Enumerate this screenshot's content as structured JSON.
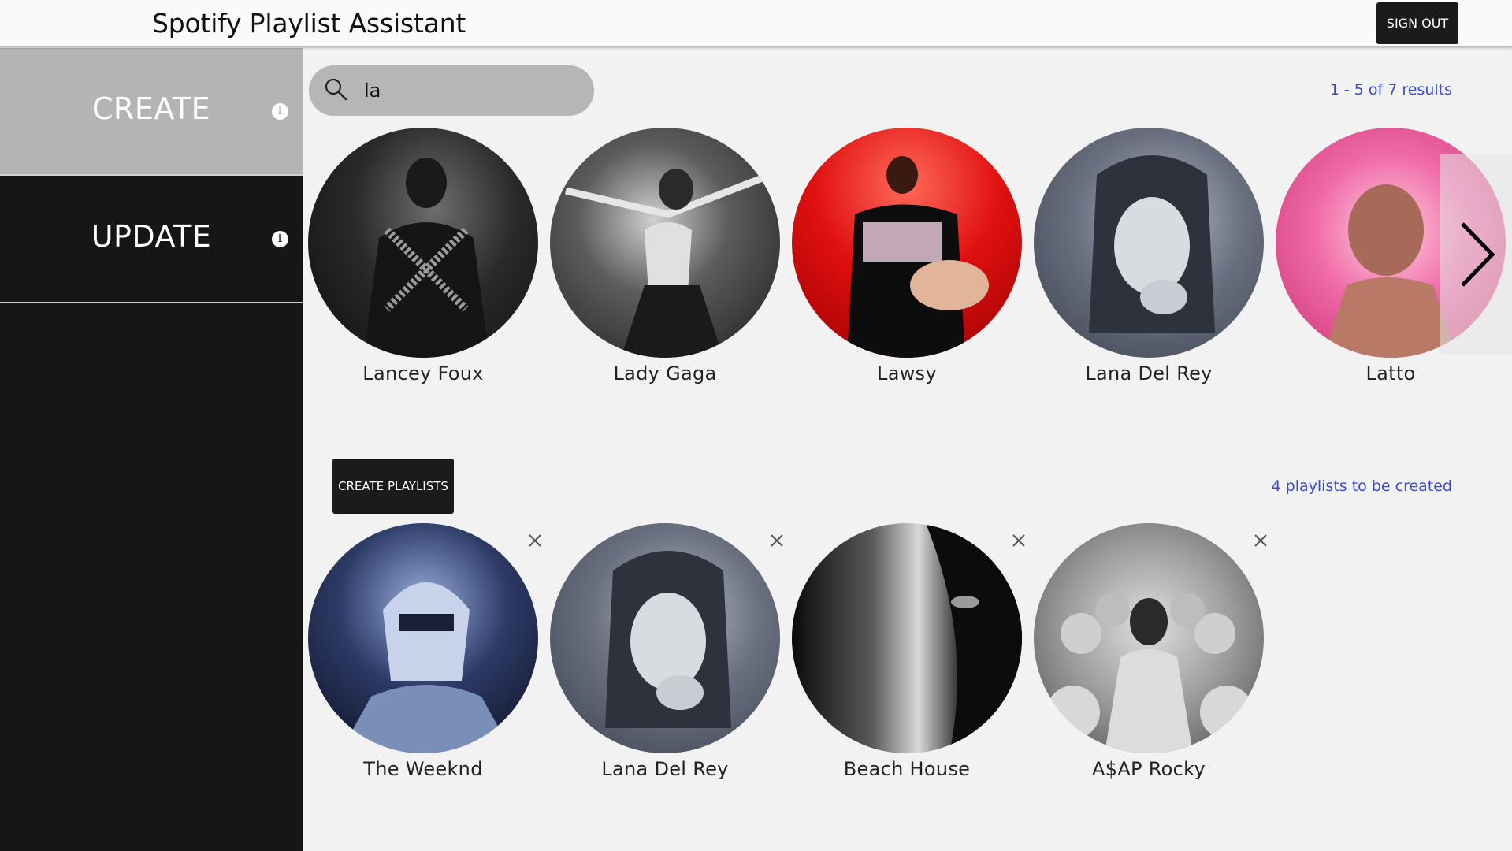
{
  "header": {
    "title": "Spotify Playlist Assistant",
    "signout_label": "SIGN OUT"
  },
  "sidebar": {
    "items": [
      {
        "label": "CREATE",
        "active": true
      },
      {
        "label": "UPDATE",
        "active": false
      }
    ],
    "info_icon": "info-icon"
  },
  "search": {
    "value": "la",
    "placeholder": ""
  },
  "results": {
    "count_text": "1 - 5 of 7 results"
  },
  "artists": [
    {
      "name": "Lancey Foux"
    },
    {
      "name": "Lady Gaga"
    },
    {
      "name": "Lawsy"
    },
    {
      "name": "Lana Del Rey"
    },
    {
      "name": "Latto"
    }
  ],
  "create_button_label": "CREATE PLAYLISTS",
  "playlist_count_text": "4 playlists to be created",
  "selected": [
    {
      "name": "The Weeknd"
    },
    {
      "name": "Lana Del Rey"
    },
    {
      "name": "Beach House"
    },
    {
      "name": "A$AP Rocky"
    }
  ],
  "colors": {
    "accent_link": "#3b4bcf",
    "sidebar_bg": "#161616",
    "active_tab_bg": "#b4b4b4"
  }
}
